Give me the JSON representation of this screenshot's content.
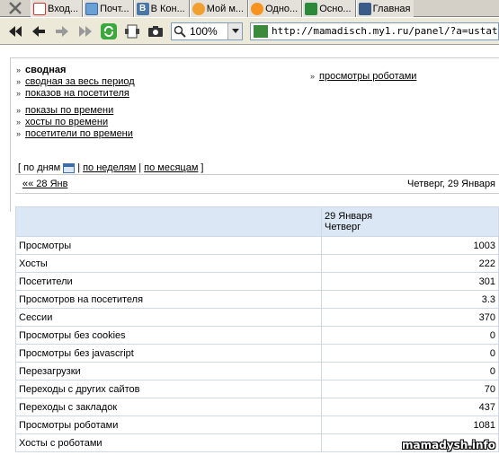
{
  "tabs": [
    {
      "label": "Вход...",
      "icon": "mail-icon"
    },
    {
      "label": "Почт...",
      "icon": "mail-icon"
    },
    {
      "label": "В Кон...",
      "icon": "vk-icon"
    },
    {
      "label": "Мой м...",
      "icon": "moimir-icon"
    },
    {
      "label": "Одно...",
      "icon": "odnoklassniki-icon"
    },
    {
      "label": "Осно...",
      "icon": "ucoz-icon"
    },
    {
      "label": "Главная",
      "icon": "home-icon"
    }
  ],
  "toolbar": {
    "zoom": "100%",
    "url": "http://mamadisch.my1.ru/panel/?a=ustat;u=ma"
  },
  "menu": {
    "title": "сводная",
    "items_a": [
      "сводная за весь период",
      "показов на посетителя"
    ],
    "items_b": [
      "показы по времени",
      "хосты по времени",
      "посетители по времени"
    ],
    "right_item": "просмотры роботами"
  },
  "periods": {
    "open": "[",
    "days": "по дням",
    "weeks": "по неделям",
    "months": "по месяцам",
    "close": "]",
    "sep": "|"
  },
  "nav": {
    "prev": "«« 28 Янв",
    "current": "Четверг, 29 Января"
  },
  "table": {
    "col_date": "29 Января",
    "col_day": "Четверг",
    "rows": [
      {
        "label": "Просмотры",
        "value": "1003"
      },
      {
        "label": "Хосты",
        "value": "222"
      },
      {
        "label": "Посетители",
        "value": "301"
      },
      {
        "label": "Просмотров на посетителя",
        "value": "3.3"
      },
      {
        "label": "Сессии",
        "value": "370"
      },
      {
        "label": "Просмотры без cookies",
        "value": "0"
      },
      {
        "label": "Просмотры без javascript",
        "value": "0"
      },
      {
        "label": "Перезагрузки",
        "value": "0"
      },
      {
        "label": "Переходы с других сайтов",
        "value": "70"
      },
      {
        "label": "Переходы с закладок",
        "value": "437"
      },
      {
        "label": "Просмотры роботами",
        "value": "1081"
      },
      {
        "label": "Хосты с роботами",
        "value": ""
      }
    ]
  },
  "watermark": "mamadysh.info"
}
